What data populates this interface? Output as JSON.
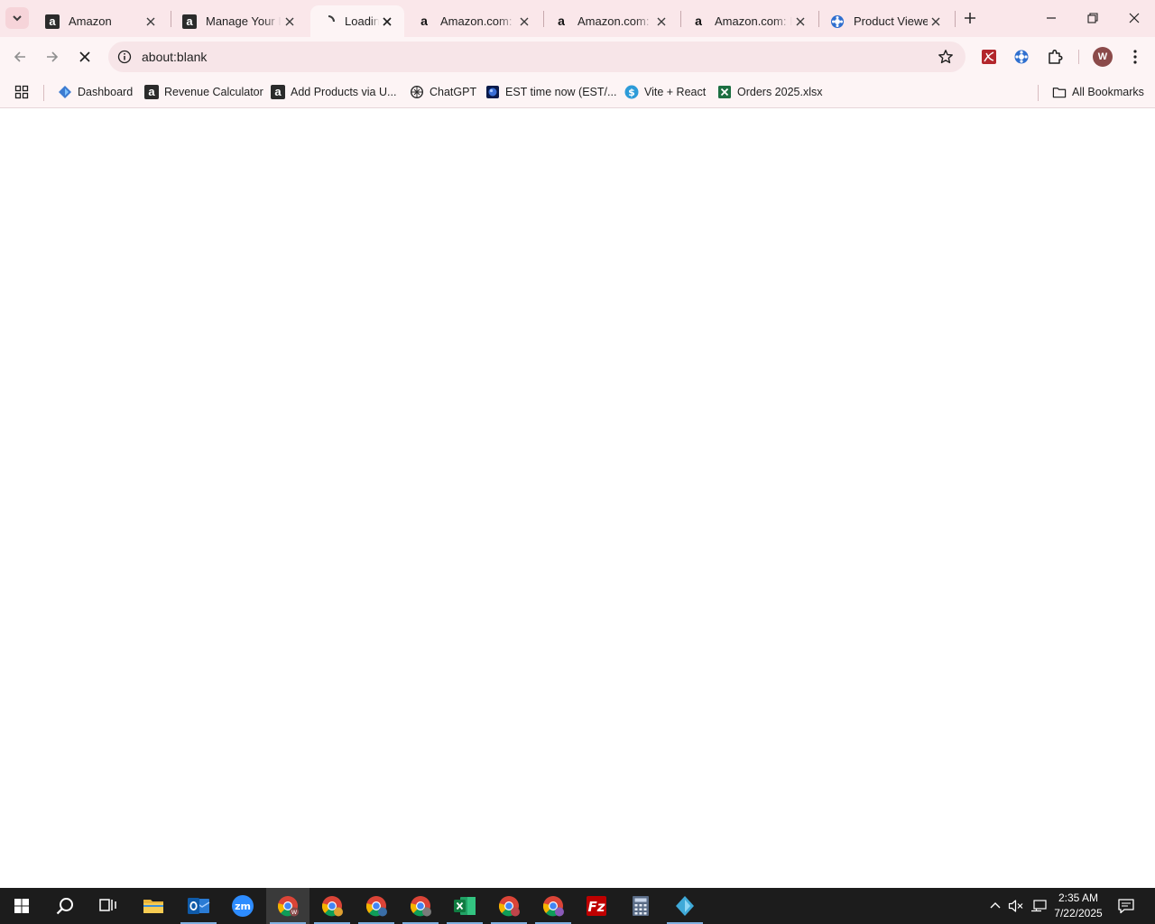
{
  "browser": {
    "tabs": [
      {
        "title": "Amazon",
        "icon": "amazon-icon",
        "active": false
      },
      {
        "title": "Manage Your Inventory",
        "icon": "amazon-icon",
        "active": false
      },
      {
        "title": "Loading...",
        "icon": "loading-spinner-icon",
        "active": true
      },
      {
        "title": "Amazon.com: Product",
        "icon": "amazon-icon",
        "active": false
      },
      {
        "title": "Amazon.com: Product",
        "icon": "amazon-icon",
        "active": false
      },
      {
        "title": "Amazon.com: Product",
        "icon": "amazon-icon",
        "active": false
      },
      {
        "title": "Product Viewer",
        "icon": "product-viewer-icon",
        "active": false
      }
    ],
    "address_bar": {
      "url": "about:blank"
    },
    "profile_initial": "W",
    "bookmarks": [
      {
        "label": "Dashboard",
        "icon": "dashboard-icon"
      },
      {
        "label": "Revenue Calculator",
        "icon": "amazon-icon"
      },
      {
        "label": "Add Products via U...",
        "icon": "amazon-icon"
      },
      {
        "label": "ChatGPT",
        "icon": "chatgpt-icon"
      },
      {
        "label": "EST time now (EST/...",
        "icon": "globe-icon"
      },
      {
        "label": "Vite + React",
        "icon": "vite-icon"
      },
      {
        "label": "Orders 2025.xlsx",
        "icon": "excel-icon"
      }
    ],
    "all_bookmarks_label": "All Bookmarks"
  },
  "taskbar": {
    "apps": [
      "start-icon",
      "search-icon",
      "task-view-icon",
      "file-explorer-icon",
      "outlook-icon",
      "zoom-icon",
      "chrome-icon",
      "chrome-icon",
      "chrome-icon",
      "chrome-icon",
      "excel-icon",
      "chrome-icon",
      "chrome-icon",
      "filezilla-icon",
      "calculator-icon",
      "app-icon"
    ],
    "time": "2:35 AM",
    "date": "7/22/2025"
  },
  "colors": {
    "tabstrip": "#fae7ea",
    "toolbar": "#fdf4f5",
    "omnibox": "#f7e5e8",
    "taskbar": "#1c1c1c"
  }
}
